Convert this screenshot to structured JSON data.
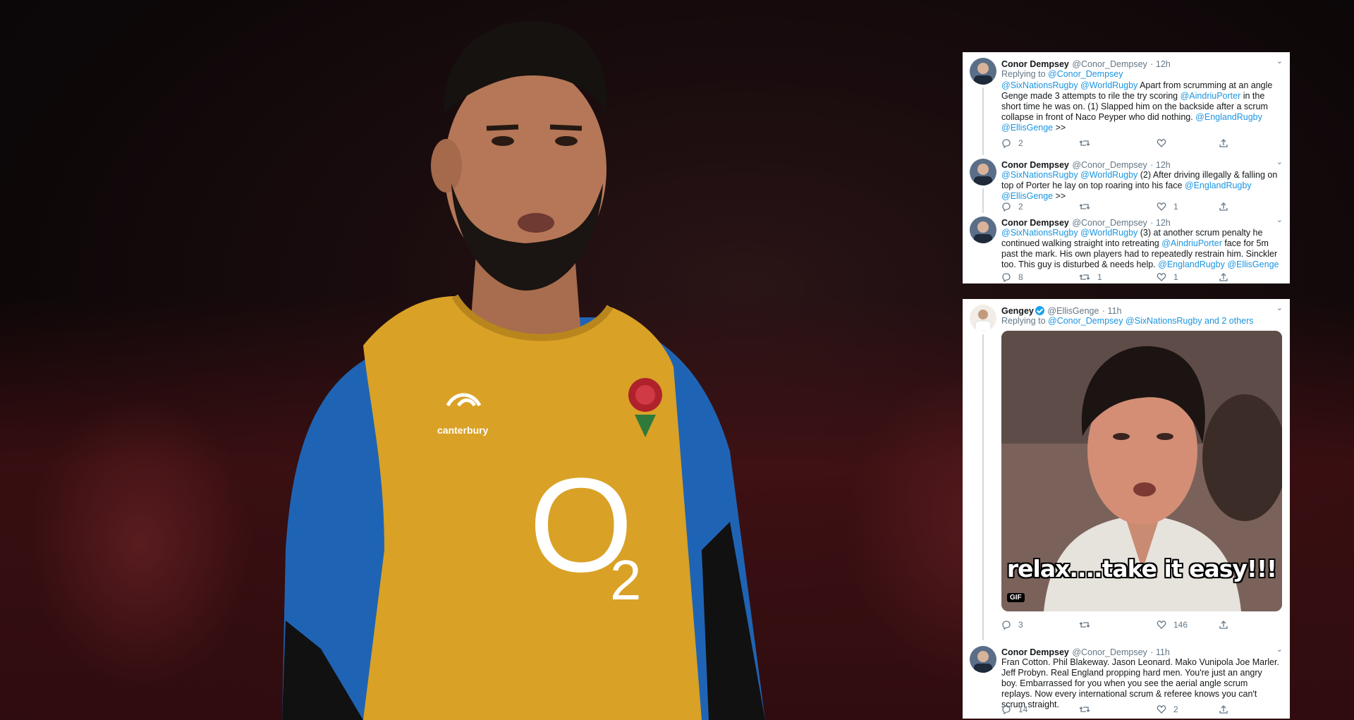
{
  "tweets": [
    {
      "name": "Conor Dempsey",
      "handle": "@Conor_Dempsey",
      "time": "· 12h",
      "reply_prefix": "Replying to ",
      "reply_to": "@Conor_Dempsey",
      "mentions": "@SixNationsRugby @WorldRugby",
      "text_a": " Apart from scrumming at an angle Genge made 3 attempts to rile the try scoring ",
      "mention_b": "@AindriuPorter",
      "text_b": " in the short time he was on. (1) Slapped him on the backside after a scrum collapse in front of Naco Peyper who did nothing. ",
      "mention_c": "@EnglandRugby",
      "mention_d": "@EllisGenge",
      "text_end": " >>",
      "replies": "2",
      "retweets": "",
      "likes": ""
    },
    {
      "name": "Conor Dempsey",
      "handle": "@Conor_Dempsey",
      "time": "· 12h",
      "mentions": "@SixNationsRugby @WorldRugby",
      "text_a": " (2) After driving illegally & falling on top of Porter he lay on top roaring into his face ",
      "mention_c": "@EnglandRugby",
      "mention_d": "@EllisGenge",
      "text_end": " >>",
      "replies": "2",
      "retweets": "",
      "likes": "1"
    },
    {
      "name": "Conor Dempsey",
      "handle": "@Conor_Dempsey",
      "time": "· 12h",
      "mentions": "@SixNationsRugby @WorldRugby",
      "text_a": "  (3) at another scrum penalty he continued walking straight into retreating  ",
      "mention_b": "@AindriuPorter",
      "text_b": " face for 5m past the mark. His own players had to  repeatedly restrain him. Sinckler too. This guy is disturbed & needs help. ",
      "mention_c": "@EnglandRugby",
      "mention_d": "@EllisGenge",
      "replies": "8",
      "retweets": "1",
      "likes": "1"
    },
    {
      "name": "Gengey",
      "handle": "@EllisGenge",
      "time": "· 11h",
      "reply_prefix": "Replying to ",
      "reply_to": "@Conor_Dempsey @SixNationsRugby and 2 others",
      "gif_caption": "relax....take it easy!!!",
      "gif_badge": "GIF",
      "replies": "3",
      "retweets": "",
      "likes": "146"
    },
    {
      "name": "Conor Dempsey",
      "handle": "@Conor_Dempsey",
      "time": "· 11h",
      "text": "Fran Cotton. Phil Blakeway. Jason Leonard. Mako Vunipola Joe Marler. Jeff Probyn. Real England propping hard men. You're just an angry boy. Embarrassed for you when you see the aerial angle scrum replays. Now every international scrum & referee knows you can't scrum straight.",
      "replies": "14",
      "retweets": "",
      "likes": "2"
    }
  ],
  "photo": {
    "bib_sponsor": "O",
    "bib_sponsor_sub": "2",
    "kit_brand": "canterbury"
  },
  "colors": {
    "link": "#1b95e0",
    "bib": "#d9a126",
    "shirt": "#1f64b4",
    "background": "#120a0b"
  }
}
